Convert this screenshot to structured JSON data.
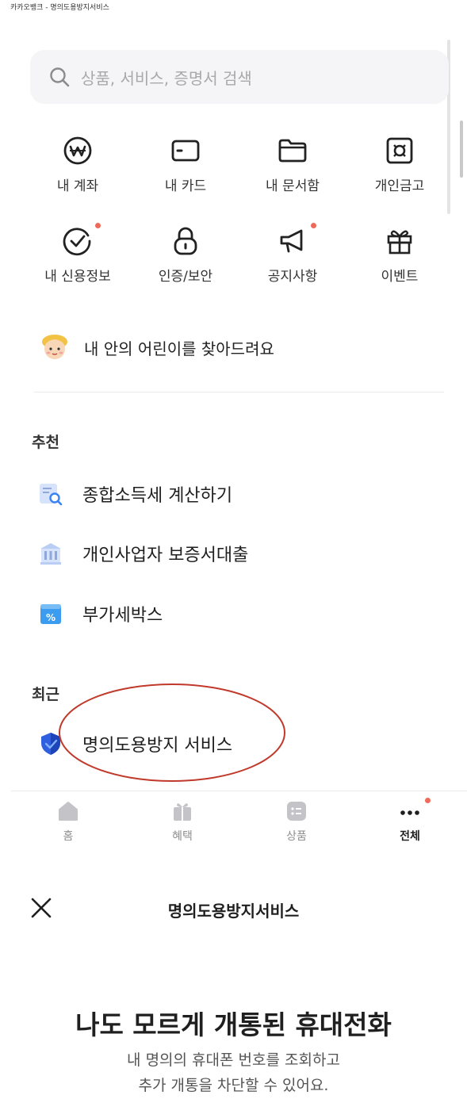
{
  "document_title": "카카오뱅크 - 명의도용방지서비스",
  "search": {
    "placeholder": "상품, 서비스, 증명서 검색",
    "icon": "search-icon"
  },
  "quick_menu": [
    {
      "label": "내 계좌",
      "icon": "won-icon",
      "badge": false
    },
    {
      "label": "내 카드",
      "icon": "card-icon",
      "badge": false
    },
    {
      "label": "내 문서함",
      "icon": "folder-icon",
      "badge": false
    },
    {
      "label": "개인금고",
      "icon": "safe-icon",
      "badge": false
    },
    {
      "label": "내 신용정보",
      "icon": "check-gauge-icon",
      "badge": true
    },
    {
      "label": "인증/보안",
      "icon": "lock-icon",
      "badge": false
    },
    {
      "label": "공지사항",
      "icon": "megaphone-icon",
      "badge": true
    },
    {
      "label": "이벤트",
      "icon": "gift-icon",
      "badge": false
    }
  ],
  "kid_banner": {
    "label": "내 안의 어린이를 찾아드려요",
    "icon": "kid-avatar-icon"
  },
  "recommend": {
    "title": "추천",
    "items": [
      {
        "label": "종합소득세 계산하기",
        "icon": "tax-search-icon"
      },
      {
        "label": "개인사업자 보증서대출",
        "icon": "bank-building-icon"
      },
      {
        "label": "부가세박스",
        "icon": "percent-box-icon"
      }
    ]
  },
  "recent": {
    "title": "최근",
    "items": [
      {
        "label": "명의도용방지 서비스",
        "icon": "shield-icon",
        "highlighted": true
      }
    ]
  },
  "tabbar": [
    {
      "label": "홈",
      "icon": "home-icon",
      "active": false,
      "badge": false
    },
    {
      "label": "혜택",
      "icon": "benefit-gift-icon",
      "active": false,
      "badge": false
    },
    {
      "label": "상품",
      "icon": "list-icon",
      "active": false,
      "badge": false
    },
    {
      "label": "전체",
      "icon": "more-icon",
      "active": true,
      "badge": true
    }
  ],
  "service_page": {
    "header_title": "명의도용방지서비스",
    "close_icon": "close-icon",
    "headline": "나도 모르게 개통된 휴대전화",
    "description_line1": "내 명의의 휴대폰 번호를 조회하고",
    "description_line2": "추가 개통을 차단할 수 있어요."
  },
  "colors": {
    "badge": "#f06a5a",
    "highlight_ellipse": "#c0392b",
    "shield": "#2f5fe0",
    "icon_blue": "#3b82f6"
  }
}
